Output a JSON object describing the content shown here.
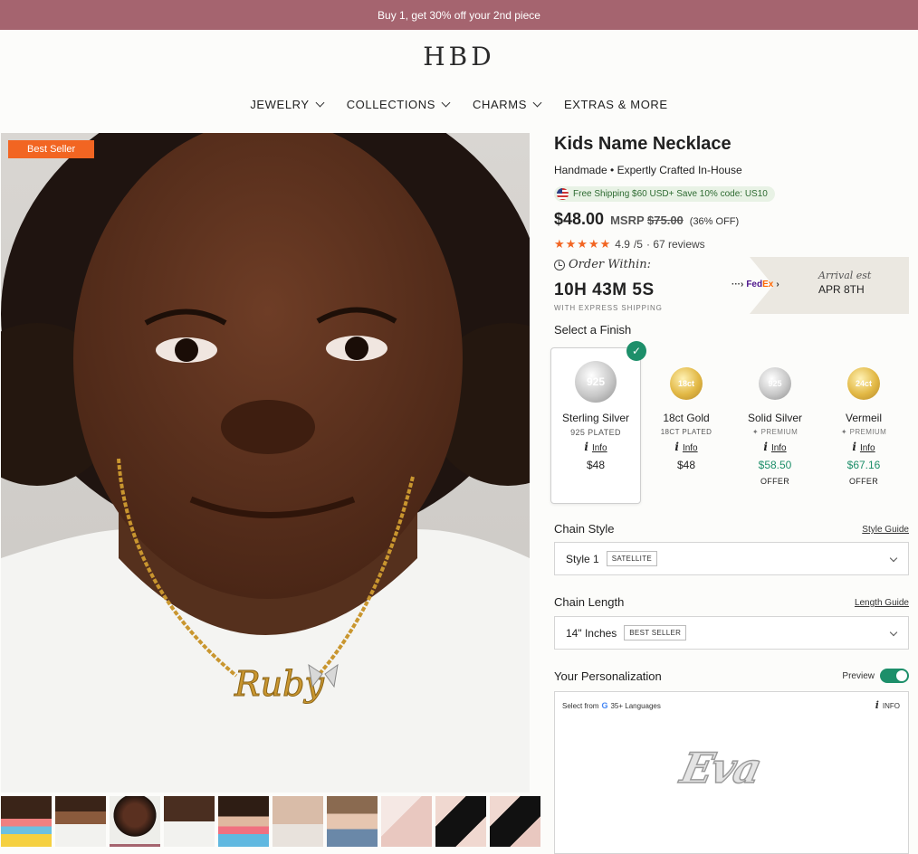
{
  "promo": "Buy 1, get 30% off your 2nd piece",
  "logo": "HBD",
  "nav": [
    {
      "label": "JEWELRY"
    },
    {
      "label": "COLLECTIONS"
    },
    {
      "label": "CHARMS"
    },
    {
      "label": "EXTRAS & MORE"
    }
  ],
  "hero": {
    "badge": "Best Seller",
    "necklace_name": "Ruby"
  },
  "product": {
    "title": "Kids Name Necklace",
    "subtitle": "Handmade • Expertly Crafted In-House",
    "shipping": "Free Shipping $60 USD+ Save 10% code: US10",
    "price": "$48.00",
    "msrp_label": "MSRP",
    "msrp_value": "$75.00",
    "discount": "(36% OFF)",
    "stars": "★★★★★",
    "rating": "4.9",
    "rating_max": "/5",
    "reviews": "· 67 reviews"
  },
  "delivery": {
    "order_label": "Order Within:",
    "countdown": "10H 43M 5S",
    "express": "WITH EXPRESS SHIPPING",
    "carrier_fe": "Fed",
    "carrier_ex": "Ex",
    "arrival_label": "Arrival est",
    "arrival_date": "APR 8TH"
  },
  "finish": {
    "label": "Select a Finish",
    "options": [
      {
        "coin": "925",
        "name": "Sterling Silver",
        "sub": "925 PLATED",
        "info": "Info",
        "price": "$48",
        "offer": "",
        "premium": "",
        "metal": "silver",
        "selected": true
      },
      {
        "coin": "18ct",
        "name": "18ct Gold",
        "sub": "18CT PLATED",
        "info": "Info",
        "price": "$48",
        "offer": "",
        "premium": "",
        "metal": "gold",
        "selected": false
      },
      {
        "coin": "925",
        "name": "Solid Silver",
        "sub": "",
        "info": "Info",
        "price": "$58.50",
        "offer": "OFFER",
        "premium": "PREMIUM",
        "metal": "silver",
        "selected": false
      },
      {
        "coin": "24ct",
        "name": "Vermeil",
        "sub": "",
        "info": "Info",
        "price": "$67.16",
        "offer": "OFFER",
        "premium": "PREMIUM",
        "metal": "gold",
        "selected": false
      }
    ]
  },
  "chain_style": {
    "label": "Chain Style",
    "guide": "Style Guide",
    "value": "Style 1",
    "tag": "SATELLITE"
  },
  "chain_length": {
    "label": "Chain Length",
    "guide": "Length Guide",
    "value": "14\" Inches",
    "tag": "BEST SELLER"
  },
  "personalization": {
    "label": "Your Personalization",
    "preview": "Preview",
    "select_from": "Select from",
    "languages": "35+ Languages",
    "info": "INFO",
    "preview_text": "Eva"
  }
}
